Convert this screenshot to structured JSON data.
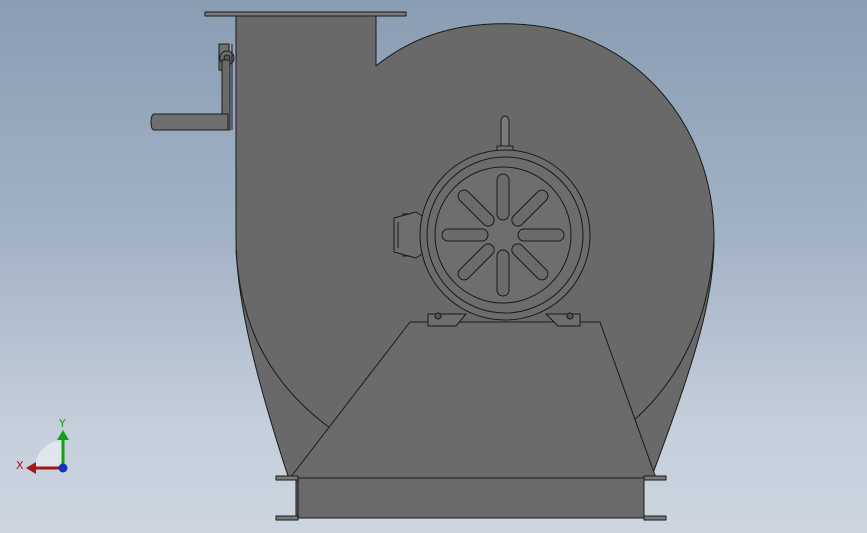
{
  "triad": {
    "x_label": "X",
    "y_label": "Y",
    "x_color": "#a01818",
    "y_color": "#14a014",
    "z_color": "#1830c0"
  },
  "colors": {
    "viewport_top": "#8a9db3",
    "viewport_bottom": "#ccd5e0",
    "housing_fill": "#696969",
    "edge_line": "#1a1a1a",
    "motor_fill": "#6e6e6e"
  }
}
